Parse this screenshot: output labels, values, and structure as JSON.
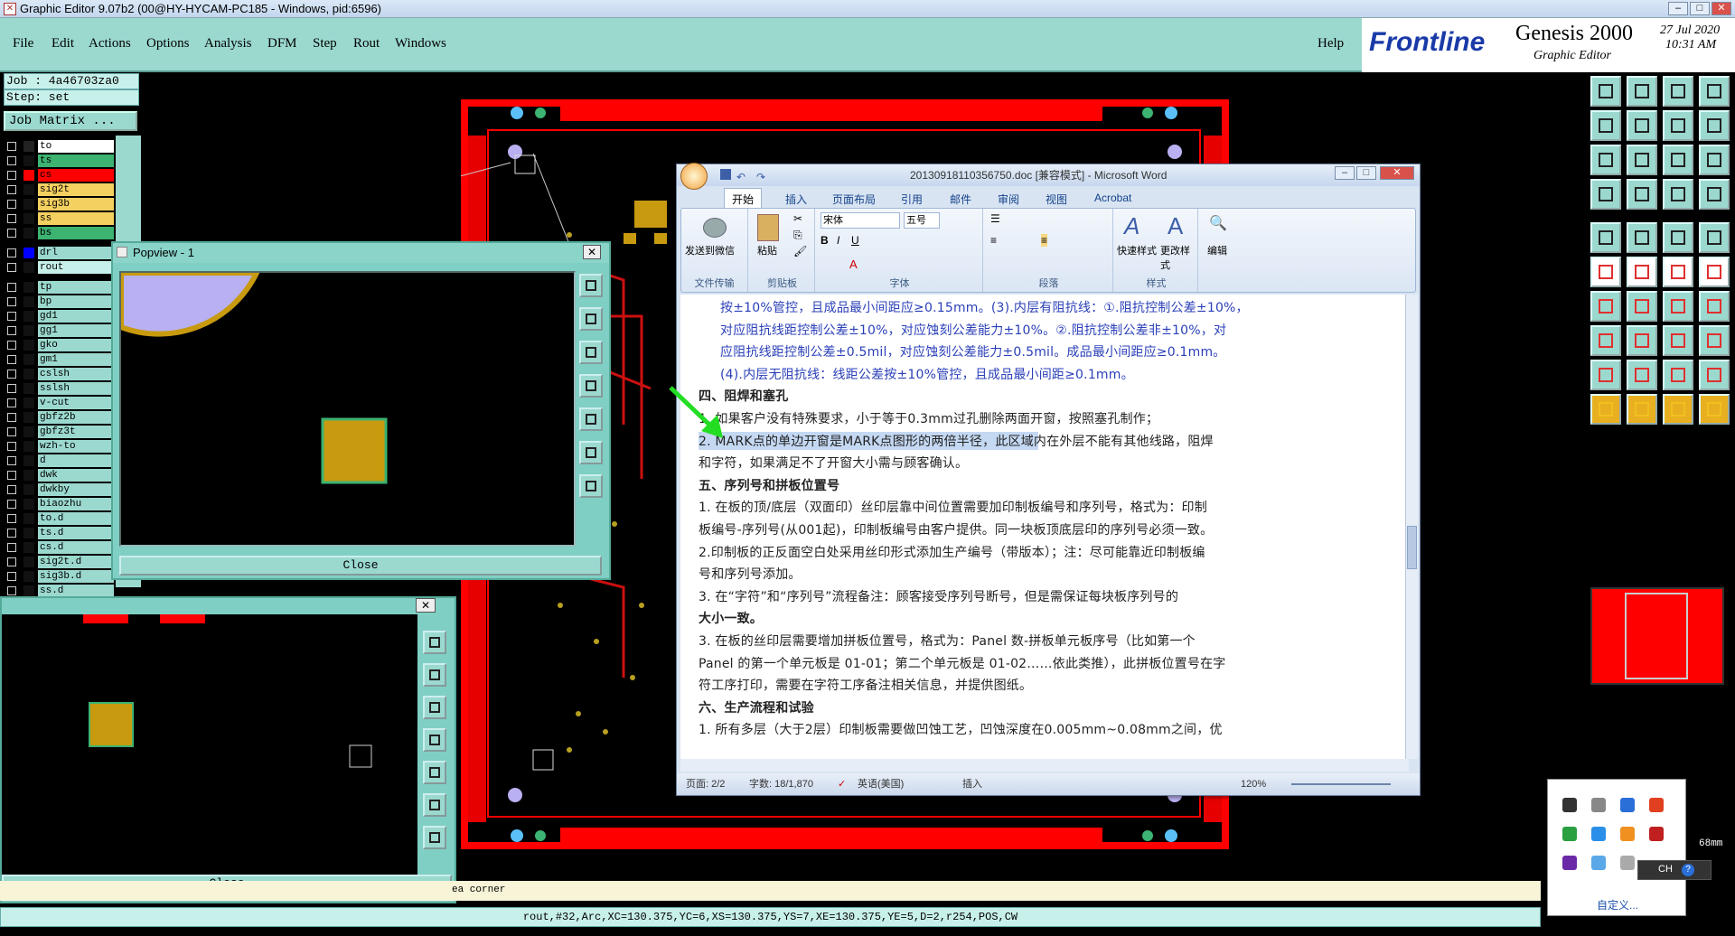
{
  "window": {
    "title": "Graphic Editor 9.07b2 (00@HY-HYCAM-PC185 - Windows, pid:6596)"
  },
  "menu": [
    "File",
    "Edit",
    "Actions",
    "Options",
    "Analysis",
    "DFM",
    "Step",
    "Rout",
    "Windows"
  ],
  "help": "Help",
  "brand": {
    "logo": "Frontline",
    "product": "Genesis 2000",
    "subtitle": "Graphic Editor",
    "date": "27 Jul 2020",
    "time": "10:31 AM"
  },
  "job": {
    "job": "Job : 4a46703za0",
    "step": "Step: set",
    "matrix": "Job Matrix ..."
  },
  "layers": [
    {
      "name": "to",
      "color": "#ffffff",
      "swatch": "#222"
    },
    {
      "name": "ts",
      "color": "#3cb371",
      "swatch": "#111"
    },
    {
      "name": "cs",
      "color": "#ff0000",
      "swatch": "#ff0000"
    },
    {
      "name": "sig2t",
      "color": "#f4d060",
      "swatch": "#111"
    },
    {
      "name": "sig3b",
      "color": "#f4d060",
      "swatch": "#111"
    },
    {
      "name": "ss",
      "color": "#f4d060",
      "swatch": "#111"
    },
    {
      "name": "bs",
      "color": "#3cb371",
      "swatch": "#111"
    },
    {
      "name": "drl",
      "color": "#9bd9cf",
      "swatch": "#0000ff"
    },
    {
      "name": "rout",
      "color": "#c8f0ea",
      "swatch": "#111"
    },
    {
      "name": "tp",
      "color": "#9bd9cf",
      "swatch": "#111"
    },
    {
      "name": "bp",
      "color": "#9bd9cf",
      "swatch": "#111"
    },
    {
      "name": "gd1",
      "color": "#9bd9cf",
      "swatch": "#111"
    },
    {
      "name": "gg1",
      "color": "#9bd9cf",
      "swatch": "#111"
    },
    {
      "name": "gko",
      "color": "#9bd9cf",
      "swatch": "#111"
    },
    {
      "name": "gm1",
      "color": "#9bd9cf",
      "swatch": "#111"
    },
    {
      "name": "cslsh",
      "color": "#9bd9cf",
      "swatch": "#111"
    },
    {
      "name": "sslsh",
      "color": "#9bd9cf",
      "swatch": "#111"
    },
    {
      "name": "v-cut",
      "color": "#9bd9cf",
      "swatch": "#111"
    },
    {
      "name": "gbfz2b",
      "color": "#9bd9cf",
      "swatch": "#111"
    },
    {
      "name": "gbfz3t",
      "color": "#9bd9cf",
      "swatch": "#111"
    },
    {
      "name": "wzh-to",
      "color": "#9bd9cf",
      "swatch": "#111"
    },
    {
      "name": "d",
      "color": "#9bd9cf",
      "swatch": "#111"
    },
    {
      "name": "dwk",
      "color": "#9bd9cf",
      "swatch": "#111"
    },
    {
      "name": "dwkby",
      "color": "#9bd9cf",
      "swatch": "#111"
    },
    {
      "name": "biaozhu",
      "color": "#9bd9cf",
      "swatch": "#111"
    },
    {
      "name": "to.d",
      "color": "#9bd9cf",
      "swatch": "#111"
    },
    {
      "name": "ts.d",
      "color": "#9bd9cf",
      "swatch": "#111"
    },
    {
      "name": "cs.d",
      "color": "#9bd9cf",
      "swatch": "#111"
    },
    {
      "name": "sig2t.d",
      "color": "#9bd9cf",
      "swatch": "#111"
    },
    {
      "name": "sig3b.d",
      "color": "#9bd9cf",
      "swatch": "#111"
    },
    {
      "name": "ss.d",
      "color": "#9bd9cf",
      "swatch": "#111"
    }
  ],
  "popview": {
    "title": "Popview - 1",
    "close": "Close"
  },
  "popview2": {
    "close": "Close"
  },
  "status": {
    "message": "ea corner",
    "coords": "rout,#32,Arc,XC=130.375,YC=6,XS=130.375,YS=7,XE=130.375,YE=5,D=2,r254,POS,CW",
    "scale": "68mm"
  },
  "word": {
    "title": "20130918110356750.doc [兼容模式] - Microsoft Word",
    "tabs": [
      "开始",
      "插入",
      "页面布局",
      "引用",
      "邮件",
      "审阅",
      "视图",
      "Acrobat"
    ],
    "groups": {
      "wechat": "发送到微信",
      "clipboard_btn": "粘贴",
      "font_name": "宋体",
      "font_size": "五号",
      "g1": "文件传输",
      "g2": "剪贴板",
      "g3": "字体",
      "g4": "段落",
      "g5": "样式",
      "quick_style": "快速样式",
      "change_style": "更改样式",
      "edit": "编辑"
    },
    "lines": [
      {
        "t": "按±10%管控，且成品最小间距应≥0.15mm。(3).内层有阻抗线：①.阻抗控制公差±10%，",
        "c": "blue"
      },
      {
        "t": "对应阻抗线距控制公差±10%，对应蚀刻公差能力±10%。②.阻抗控制公差非±10%，对",
        "c": "blue"
      },
      {
        "t": "应阻抗线距控制公差±0.5mil，对应蚀刻公差能力±0.5mil。成品最小间距应≥0.1mm。",
        "c": "blue"
      },
      {
        "t": "(4).内层无阻抗线：线距公差按±10%管控，且成品最小间距≥0.1mm。",
        "c": "blue"
      },
      {
        "t": "四、阻焊和塞孔",
        "c": "bold"
      },
      {
        "t": "1. 如果客户没有特殊要求，小于等于0.3mm过孔删除两面开窗，按照塞孔制作；",
        "c": ""
      },
      {
        "t": "2. MARK点的单边开窗是MARK点图形的两倍半径，此区域内在外层不能有其他线路，阻焊",
        "c": ""
      },
      {
        "t": "和字符，如果满足不了开窗大小需与顾客确认。",
        "c": ""
      },
      {
        "t": "五、序列号和拼板位置号",
        "c": "bold"
      },
      {
        "t": "1. 在板的顶/底层（双面印）丝印层靠中间位置需要加印制板编号和序列号，格式为：印制",
        "c": ""
      },
      {
        "t": "板编号-序列号(从001起)，印制板编号由客户提供。同一块板顶底层印的序列号必须一致。",
        "c": ""
      },
      {
        "t": "2.印制板的正反面空白处采用丝印形式添加生产编号（带版本）；注：尽可能靠近印制板编",
        "c": ""
      },
      {
        "t": "号和序列号添加。",
        "c": ""
      },
      {
        "t": "3. 在“字符”和“序列号”流程备注：顾客接受序列号断号，但是需保证每块板序列号的",
        "c": ""
      },
      {
        "t": "大小一致。",
        "c": "bold"
      },
      {
        "t": "3. 在板的丝印层需要增加拼板位置号，格式为：Panel 数-拼板单元板序号（比如第一个",
        "c": ""
      },
      {
        "t": "Panel 的第一个单元板是 01-01；第二个单元板是 01-02……依此类推），此拼板位置号在字",
        "c": ""
      },
      {
        "t": "符工序打印，需要在字符工序备注相关信息，并提供图纸。",
        "c": ""
      },
      {
        "t": "六、生产流程和试验",
        "c": "bold"
      },
      {
        "t": "1. 所有多层（大于2层）印制板需要做凹蚀工艺，凹蚀深度在0.005mm~0.08mm之间，优",
        "c": ""
      }
    ],
    "status": {
      "page": "页面: 2/2",
      "words": "字数: 18/1,870",
      "lang": "英语(美国)",
      "mode": "插入",
      "zoom": "120%"
    }
  },
  "tray": {
    "customize": "自定义...",
    "ime": "CH"
  }
}
